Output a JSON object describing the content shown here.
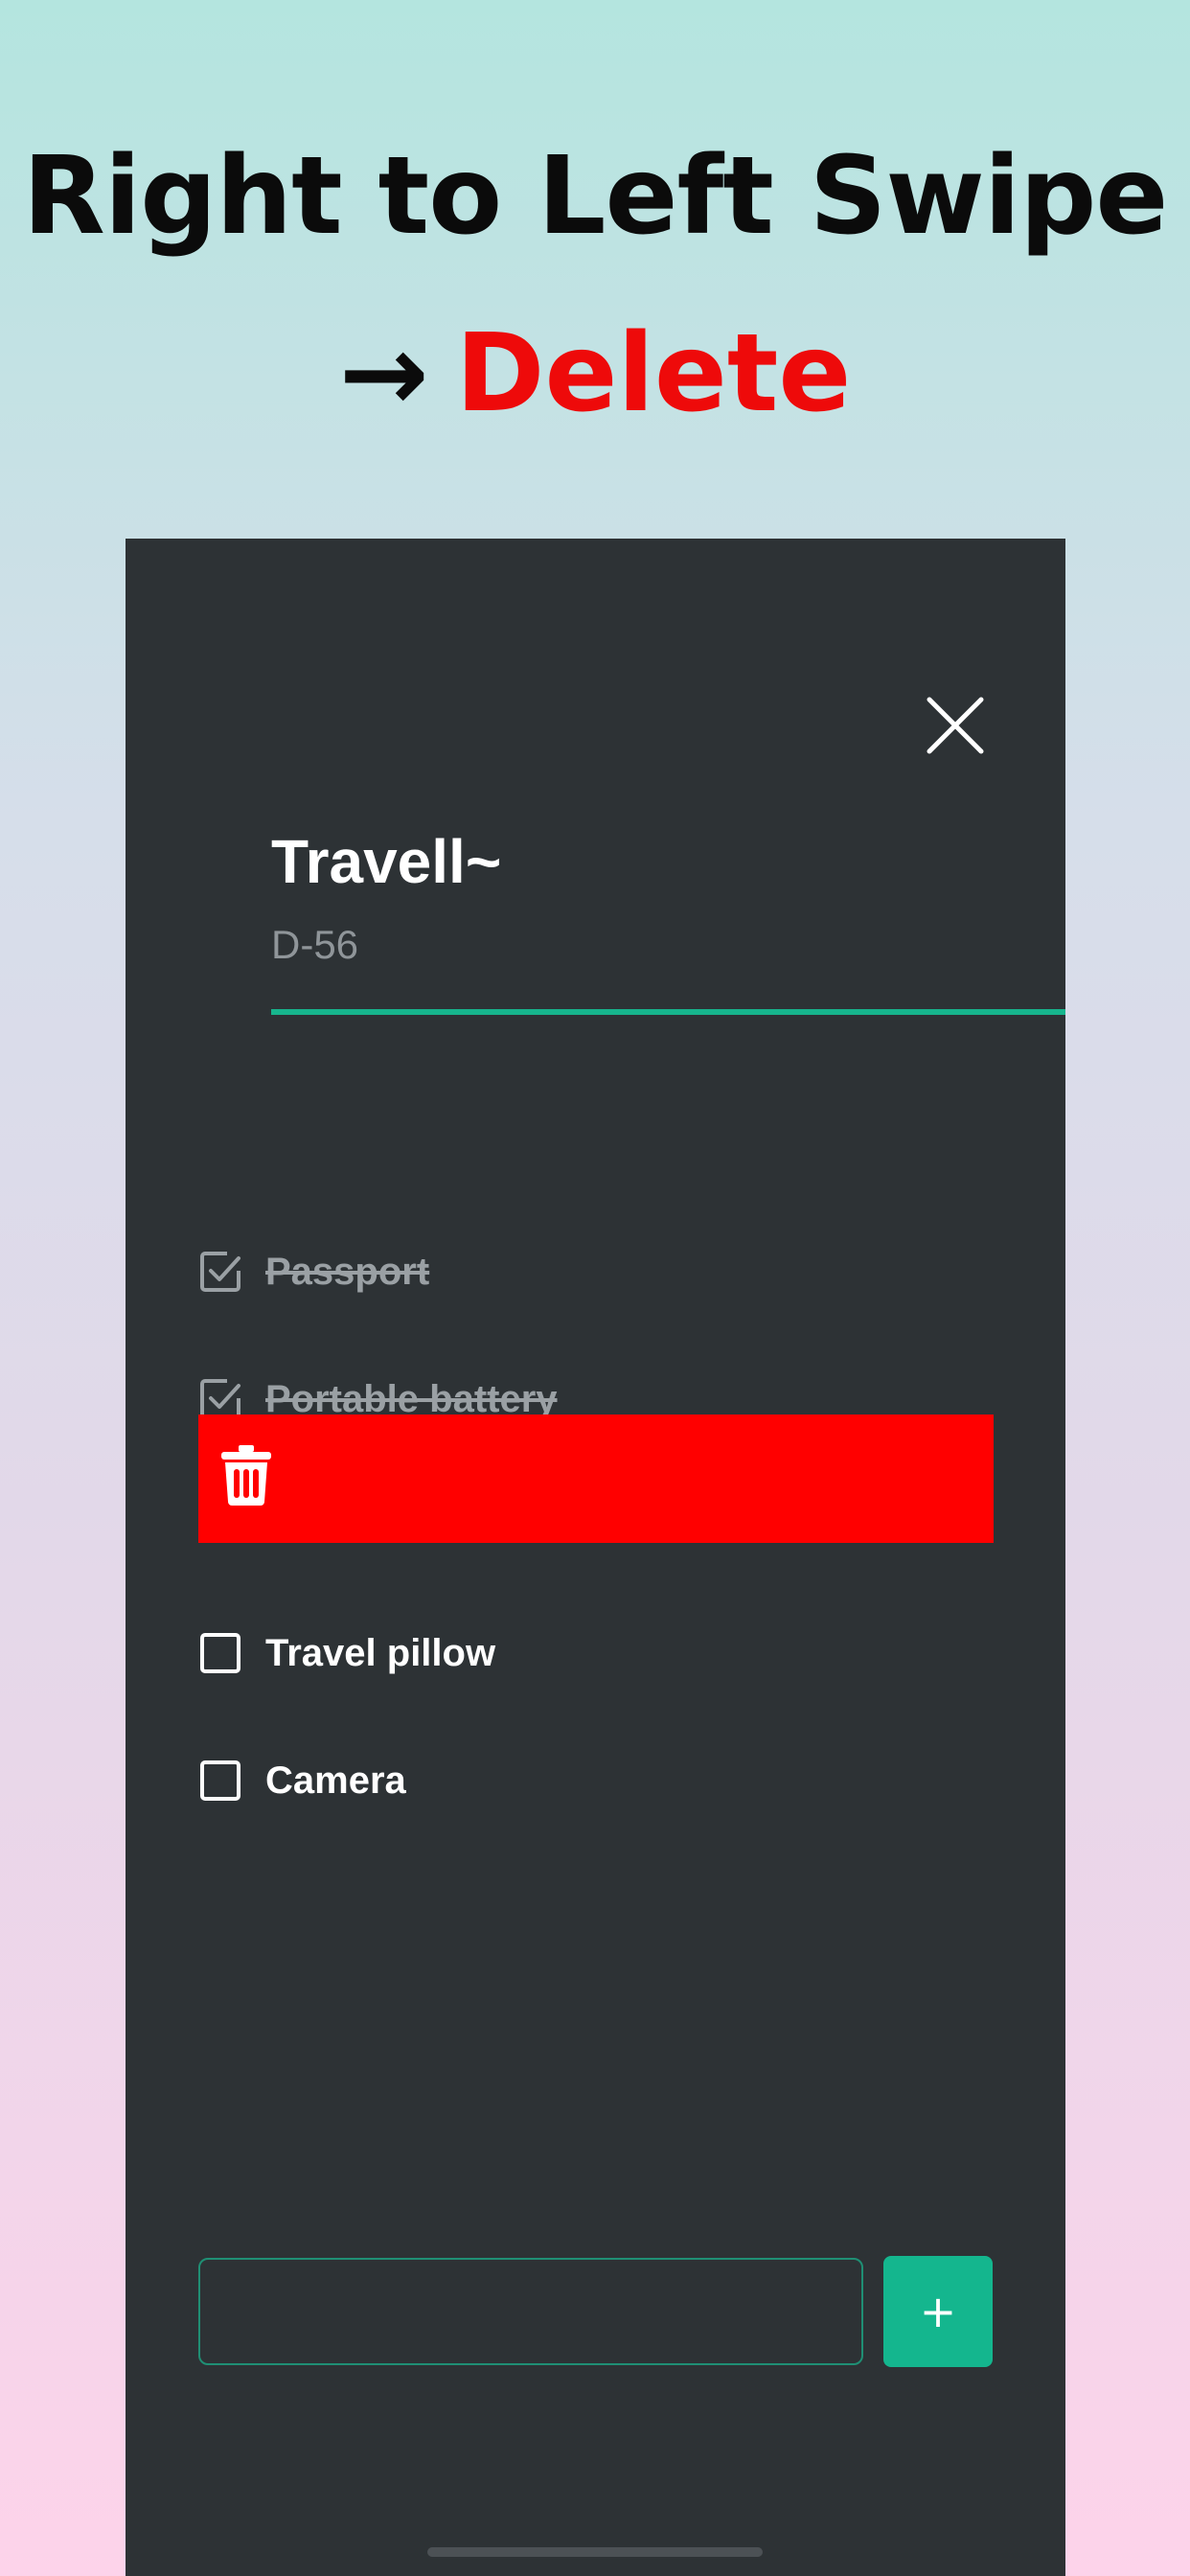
{
  "promo": {
    "headline": "Right to Left Swipe",
    "arrow": "→",
    "action_word": "Delete"
  },
  "screen": {
    "close_icon": "close-icon",
    "list_title": "Travell~",
    "list_subtitle": "D-56",
    "items": [
      {
        "label": "Passport",
        "done": true
      },
      {
        "label": "Portable battery",
        "done": true
      },
      {
        "label": "Travel pillow",
        "done": false
      },
      {
        "label": "Camera",
        "done": false
      }
    ],
    "swipe_action": {
      "icon": "trash-icon",
      "color": "#ff0000"
    },
    "add_input": {
      "value": "",
      "placeholder": ""
    },
    "add_button_label": "+"
  },
  "colors": {
    "accent": "#14b68e",
    "screen_background": "#2d3235",
    "delete": "#ff0000"
  }
}
